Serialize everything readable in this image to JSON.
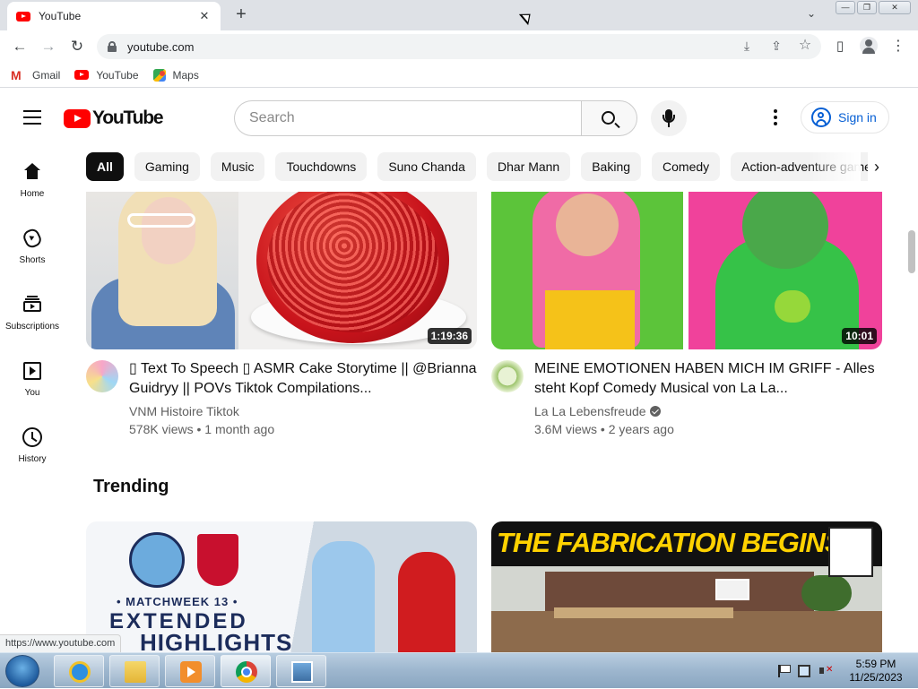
{
  "browser": {
    "tab_title": "YouTube",
    "tab_close": "✕",
    "new_tab": "+",
    "tab_search": "⌄",
    "window_controls": {
      "minimize": "—",
      "maximize": "❐",
      "close": "✕"
    },
    "nav": {
      "back": "←",
      "forward": "→",
      "reload": "↻"
    },
    "url": "youtube.com",
    "omnibox_icons": {
      "install": "⤓",
      "share": "⇪",
      "bookmark": "☆"
    },
    "toolbar_icons": {
      "side_panel": "▯",
      "menu": "⋮"
    },
    "bookmarks": [
      {
        "label": "Gmail",
        "icon": "gmail-icon"
      },
      {
        "label": "YouTube",
        "icon": "youtube-icon"
      },
      {
        "label": "Maps",
        "icon": "maps-icon"
      }
    ],
    "status_url": "https://www.youtube.com"
  },
  "header": {
    "logo_text": "YouTube",
    "search_placeholder": "Search",
    "signin_label": "Sign in"
  },
  "chips": [
    "All",
    "Gaming",
    "Music",
    "Touchdowns",
    "Suno Chanda",
    "Dhar Mann",
    "Baking",
    "Comedy",
    "Action-adventure games"
  ],
  "chips_next": "›",
  "sidebar": {
    "items": [
      {
        "label": "Home",
        "icon": "home-icon"
      },
      {
        "label": "Shorts",
        "icon": "shorts-icon"
      },
      {
        "label": "Subscriptions",
        "icon": "subscriptions-icon"
      },
      {
        "label": "You",
        "icon": "you-icon"
      },
      {
        "label": "History",
        "icon": "history-icon"
      }
    ]
  },
  "videos": [
    {
      "title": "▯ Text To Speech ▯ ASMR Cake Storytime || @Brianna Guidryy || POVs Tiktok Compilations...",
      "channel": "VNM Histoire Tiktok",
      "meta": "578K views • 1 month ago",
      "duration": "1:19:36",
      "verified": false
    },
    {
      "title": "MEINE EMOTIONEN HABEN MICH IM GRIFF - Alles steht Kopf Comedy Musical von La La...",
      "channel": "La La Lebensfreude",
      "meta": "3.6M views • 2 years ago",
      "duration": "10:01",
      "verified": true
    }
  ],
  "trending": {
    "title": "Trending",
    "videos": [
      {
        "thumb_text_1": "• MATCHWEEK 13 •",
        "thumb_text_2": "EXTENDED",
        "thumb_text_3": "HIGHLIGHTS"
      },
      {
        "thumb_text_1": "THE FABRICATION BEGINS"
      }
    ]
  },
  "taskbar": {
    "apps": [
      "internet-explorer",
      "file-explorer",
      "media-player",
      "chrome",
      "photo-viewer"
    ],
    "time": "5:59 PM",
    "date": "11/25/2023"
  },
  "colors": {
    "accent": "#ff0000",
    "signin_blue": "#065fd4",
    "chip_active": "#0f0f0f"
  }
}
